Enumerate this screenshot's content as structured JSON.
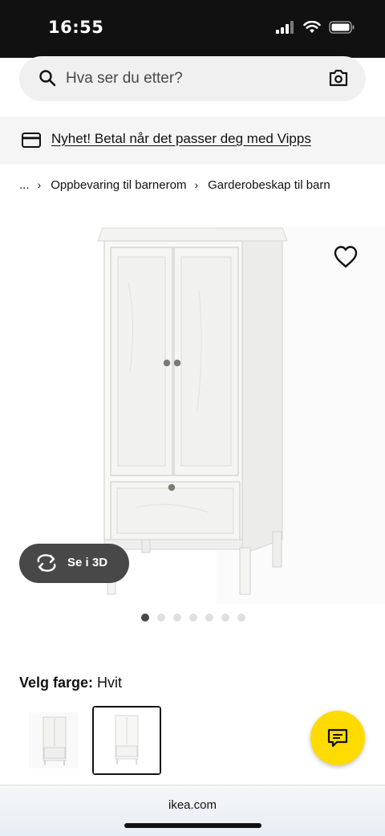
{
  "status_bar": {
    "time": "16:55"
  },
  "search": {
    "placeholder": "Hva ser du etter?"
  },
  "promo": {
    "text": "Nyhet! Betal når det passer deg med Vipps"
  },
  "breadcrumb": {
    "ellipsis": "...",
    "items": [
      "Oppbevaring til barnerom",
      "Garderobeskap til barn"
    ]
  },
  "gallery": {
    "view_3d_label": "Se i 3D",
    "dot_count": 7,
    "active_dot": 0
  },
  "color": {
    "label": "Velg farge:",
    "value": "Hvit",
    "swatches": [
      "Hvit (alternativ 1)",
      "Hvit (valgt)"
    ]
  },
  "browser": {
    "url": "ikea.com"
  },
  "colors": {
    "status_bar_bg": "#111111",
    "search_bg": "#f0f0f0",
    "promo_bg": "#f5f5f5",
    "button_dark": "#484848",
    "chat_yellow": "#ffdb00",
    "active_dot": "#484848",
    "inactive_dot": "#dfdfdf"
  },
  "icons": [
    "signal-icon",
    "wifi-icon",
    "battery-icon",
    "search-icon",
    "camera-icon",
    "card-icon",
    "heart-icon",
    "rotate-3d-icon",
    "chat-icon"
  ]
}
